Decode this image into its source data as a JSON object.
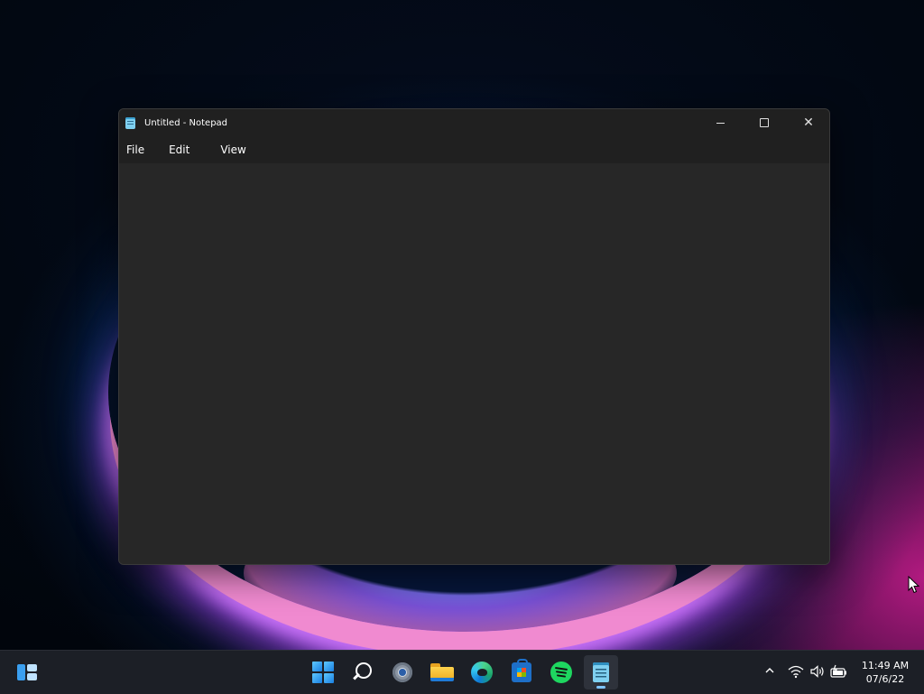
{
  "window": {
    "title": "Untitled - Notepad",
    "menu": [
      "File",
      "Edit",
      "View"
    ],
    "editor_text": "",
    "controls": {
      "minimize": "minimize",
      "maximize": "maximize",
      "close": "close"
    }
  },
  "taskbar": {
    "pinned": [
      {
        "name": "widgets",
        "icon": "widgets-icon"
      },
      {
        "name": "start",
        "icon": "windows-start-icon"
      },
      {
        "name": "search",
        "icon": "search-icon"
      },
      {
        "name": "settings",
        "icon": "gear-icon"
      },
      {
        "name": "file-explorer",
        "icon": "folder-icon"
      },
      {
        "name": "edge",
        "icon": "edge-icon"
      },
      {
        "name": "microsoft-store",
        "icon": "store-icon"
      },
      {
        "name": "spotify",
        "icon": "spotify-icon"
      },
      {
        "name": "notepad",
        "icon": "notepad-icon",
        "active": true
      }
    ],
    "tray": {
      "time": "11:49 AM",
      "date": "07/6/22"
    }
  },
  "colors": {
    "window_bg": "#272727",
    "titlebar_bg": "#202020",
    "taskbar_bg": "#1c1f26",
    "accent": "#7fc4ff"
  }
}
